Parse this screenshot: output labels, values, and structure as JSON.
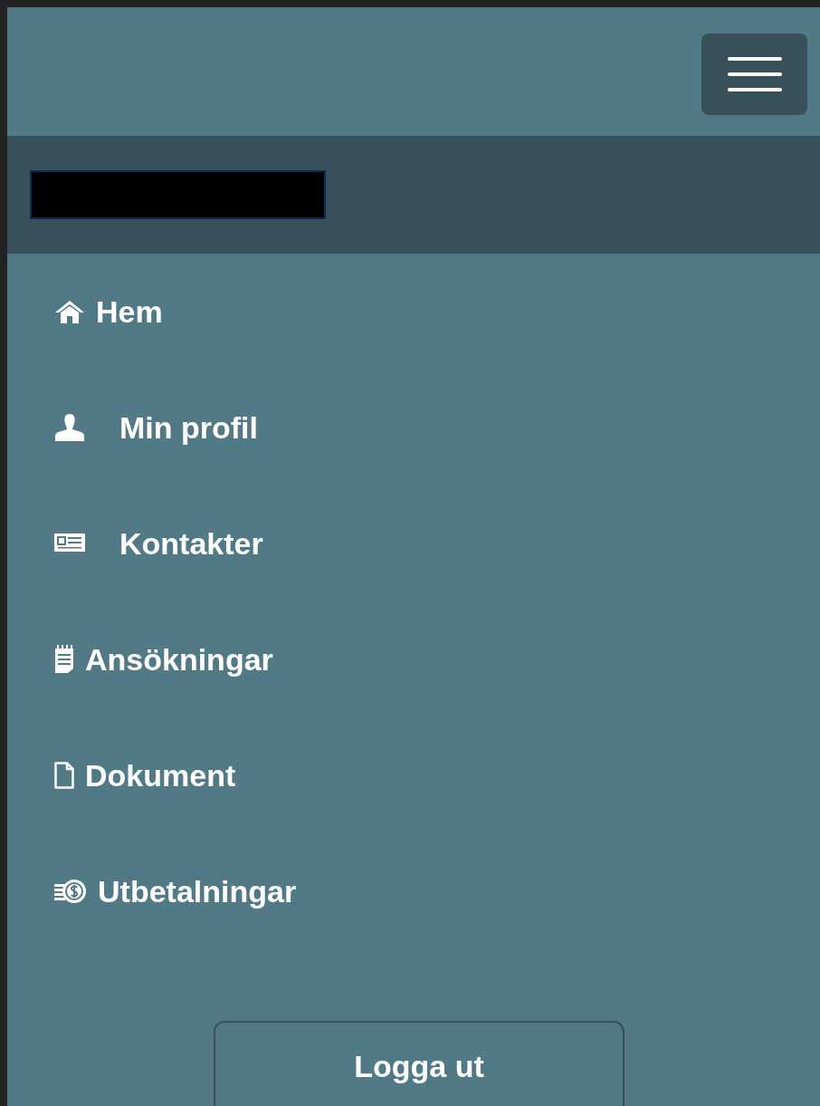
{
  "nav": {
    "items": [
      {
        "label": "Hem"
      },
      {
        "label": "Min profil"
      },
      {
        "label": "Kontakter"
      },
      {
        "label": "Ansökningar"
      },
      {
        "label": "Dokument"
      },
      {
        "label": "Utbetalningar"
      }
    ]
  },
  "logout_button": {
    "label": "Logga ut"
  }
}
